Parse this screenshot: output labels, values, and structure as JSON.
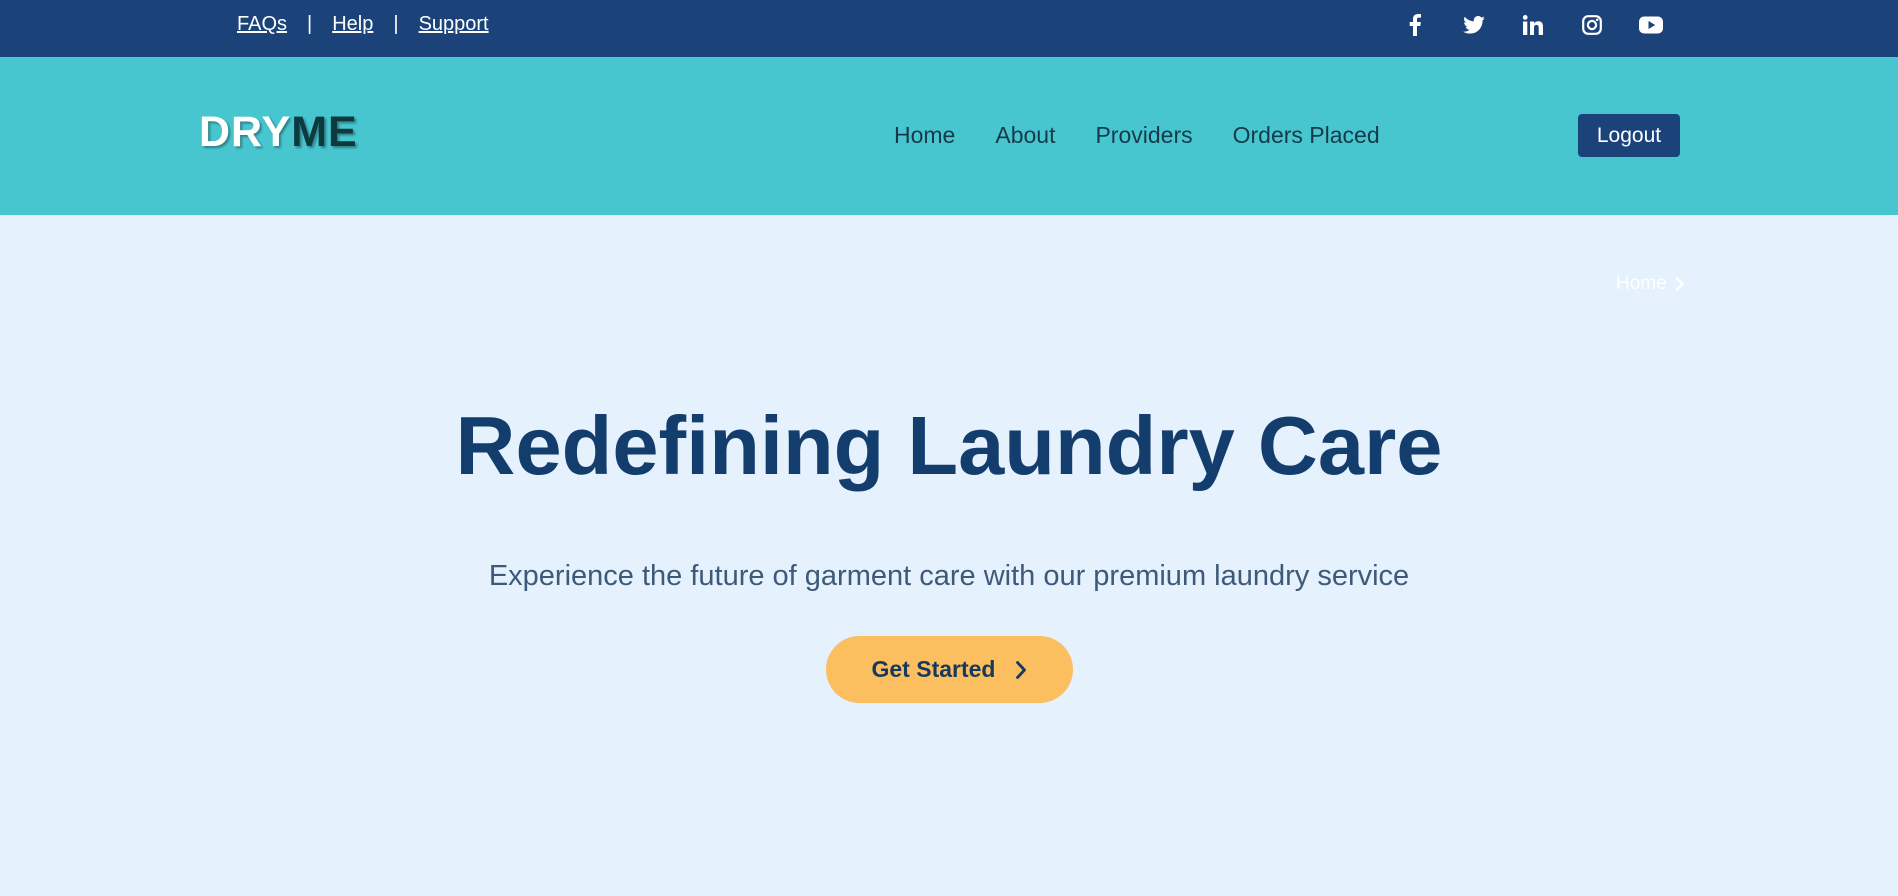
{
  "topbar": {
    "links": [
      "FAQs",
      "Help",
      "Support"
    ],
    "separator": "|",
    "social_icons": [
      "facebook-icon",
      "twitter-icon",
      "linkedin-icon",
      "instagram-icon",
      "youtube-icon"
    ]
  },
  "header": {
    "logo_part1": "DRY",
    "logo_part2": "ME",
    "nav": [
      "Home",
      "About",
      "Providers",
      "Orders Placed"
    ],
    "logout_label": "Logout"
  },
  "hero": {
    "breadcrumb": "Home",
    "title": "Redefining Laundry Care",
    "subtitle": "Experience the future of garment care with our premium laundry service",
    "cta_label": "Get Started"
  },
  "colors": {
    "topbar_bg": "#1b4379",
    "header_bg": "#47c6d0",
    "page_bg": "#e5f1fc",
    "cta_bg": "#fbbf5f",
    "title_color": "#133d6c"
  }
}
